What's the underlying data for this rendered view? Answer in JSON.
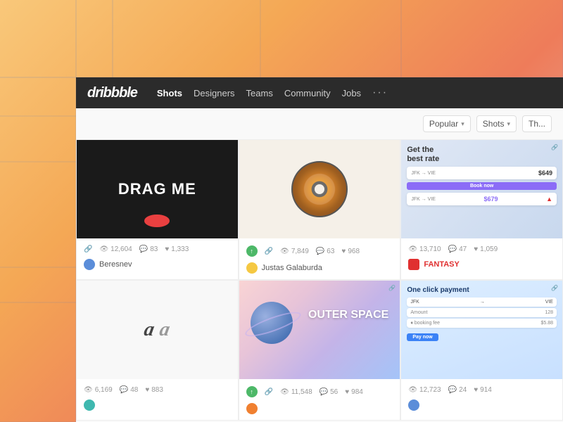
{
  "background": {
    "gradient_desc": "warm orange-pink gradient"
  },
  "navbar": {
    "logo": "dribbble",
    "items": [
      {
        "label": "Shots",
        "active": true
      },
      {
        "label": "Designers",
        "active": false
      },
      {
        "label": "Teams",
        "active": false
      },
      {
        "label": "Community",
        "active": false
      },
      {
        "label": "Jobs",
        "active": false
      },
      {
        "label": "···",
        "active": false
      }
    ]
  },
  "filters": {
    "popular_label": "Popular",
    "shots_label": "Shots",
    "this_label": "Th..."
  },
  "shots_row1": [
    {
      "type": "drag_me",
      "title": "DRAG ME",
      "stats": {
        "views": "12,604",
        "comments": "83",
        "likes": "1,333"
      },
      "author": "Beresnev",
      "avatar_color": "blue",
      "selected": true
    },
    {
      "type": "vinyl",
      "title": "Vinyl disc illustration",
      "stats": {
        "views": "7,849",
        "comments": "63",
        "likes": "968"
      },
      "author": "Justas Galaburda",
      "avatar_color": "yellow",
      "has_upload": true
    },
    {
      "type": "flight",
      "title": "Get the best rate",
      "flight_cards": [
        {
          "route": "JFK → VIE",
          "price": "$649",
          "type": "normal"
        },
        {
          "route": "JFK → VIE",
          "price": "$679",
          "type": "highlight",
          "btn": "Book now"
        }
      ],
      "stats": {
        "views": "13,710",
        "comments": "47",
        "likes": "1,059"
      },
      "author": "FANTASY",
      "avatar_color": "red"
    }
  ],
  "shots_row2": [
    {
      "type": "logo",
      "stats": {
        "views": "6,169",
        "comments": "48",
        "likes": "883"
      },
      "author": "",
      "avatar_color": "teal"
    },
    {
      "type": "outer_space",
      "title": "OUTER SPACE",
      "stats": {
        "views": "11,548",
        "comments": "56",
        "likes": "984"
      },
      "author": "",
      "avatar_color": "orange",
      "has_upload": true
    },
    {
      "type": "payment",
      "title": "One click payment",
      "stats": {
        "views": "12,723",
        "comments": "24",
        "likes": "914"
      },
      "author": "",
      "avatar_color": "blue"
    }
  ]
}
